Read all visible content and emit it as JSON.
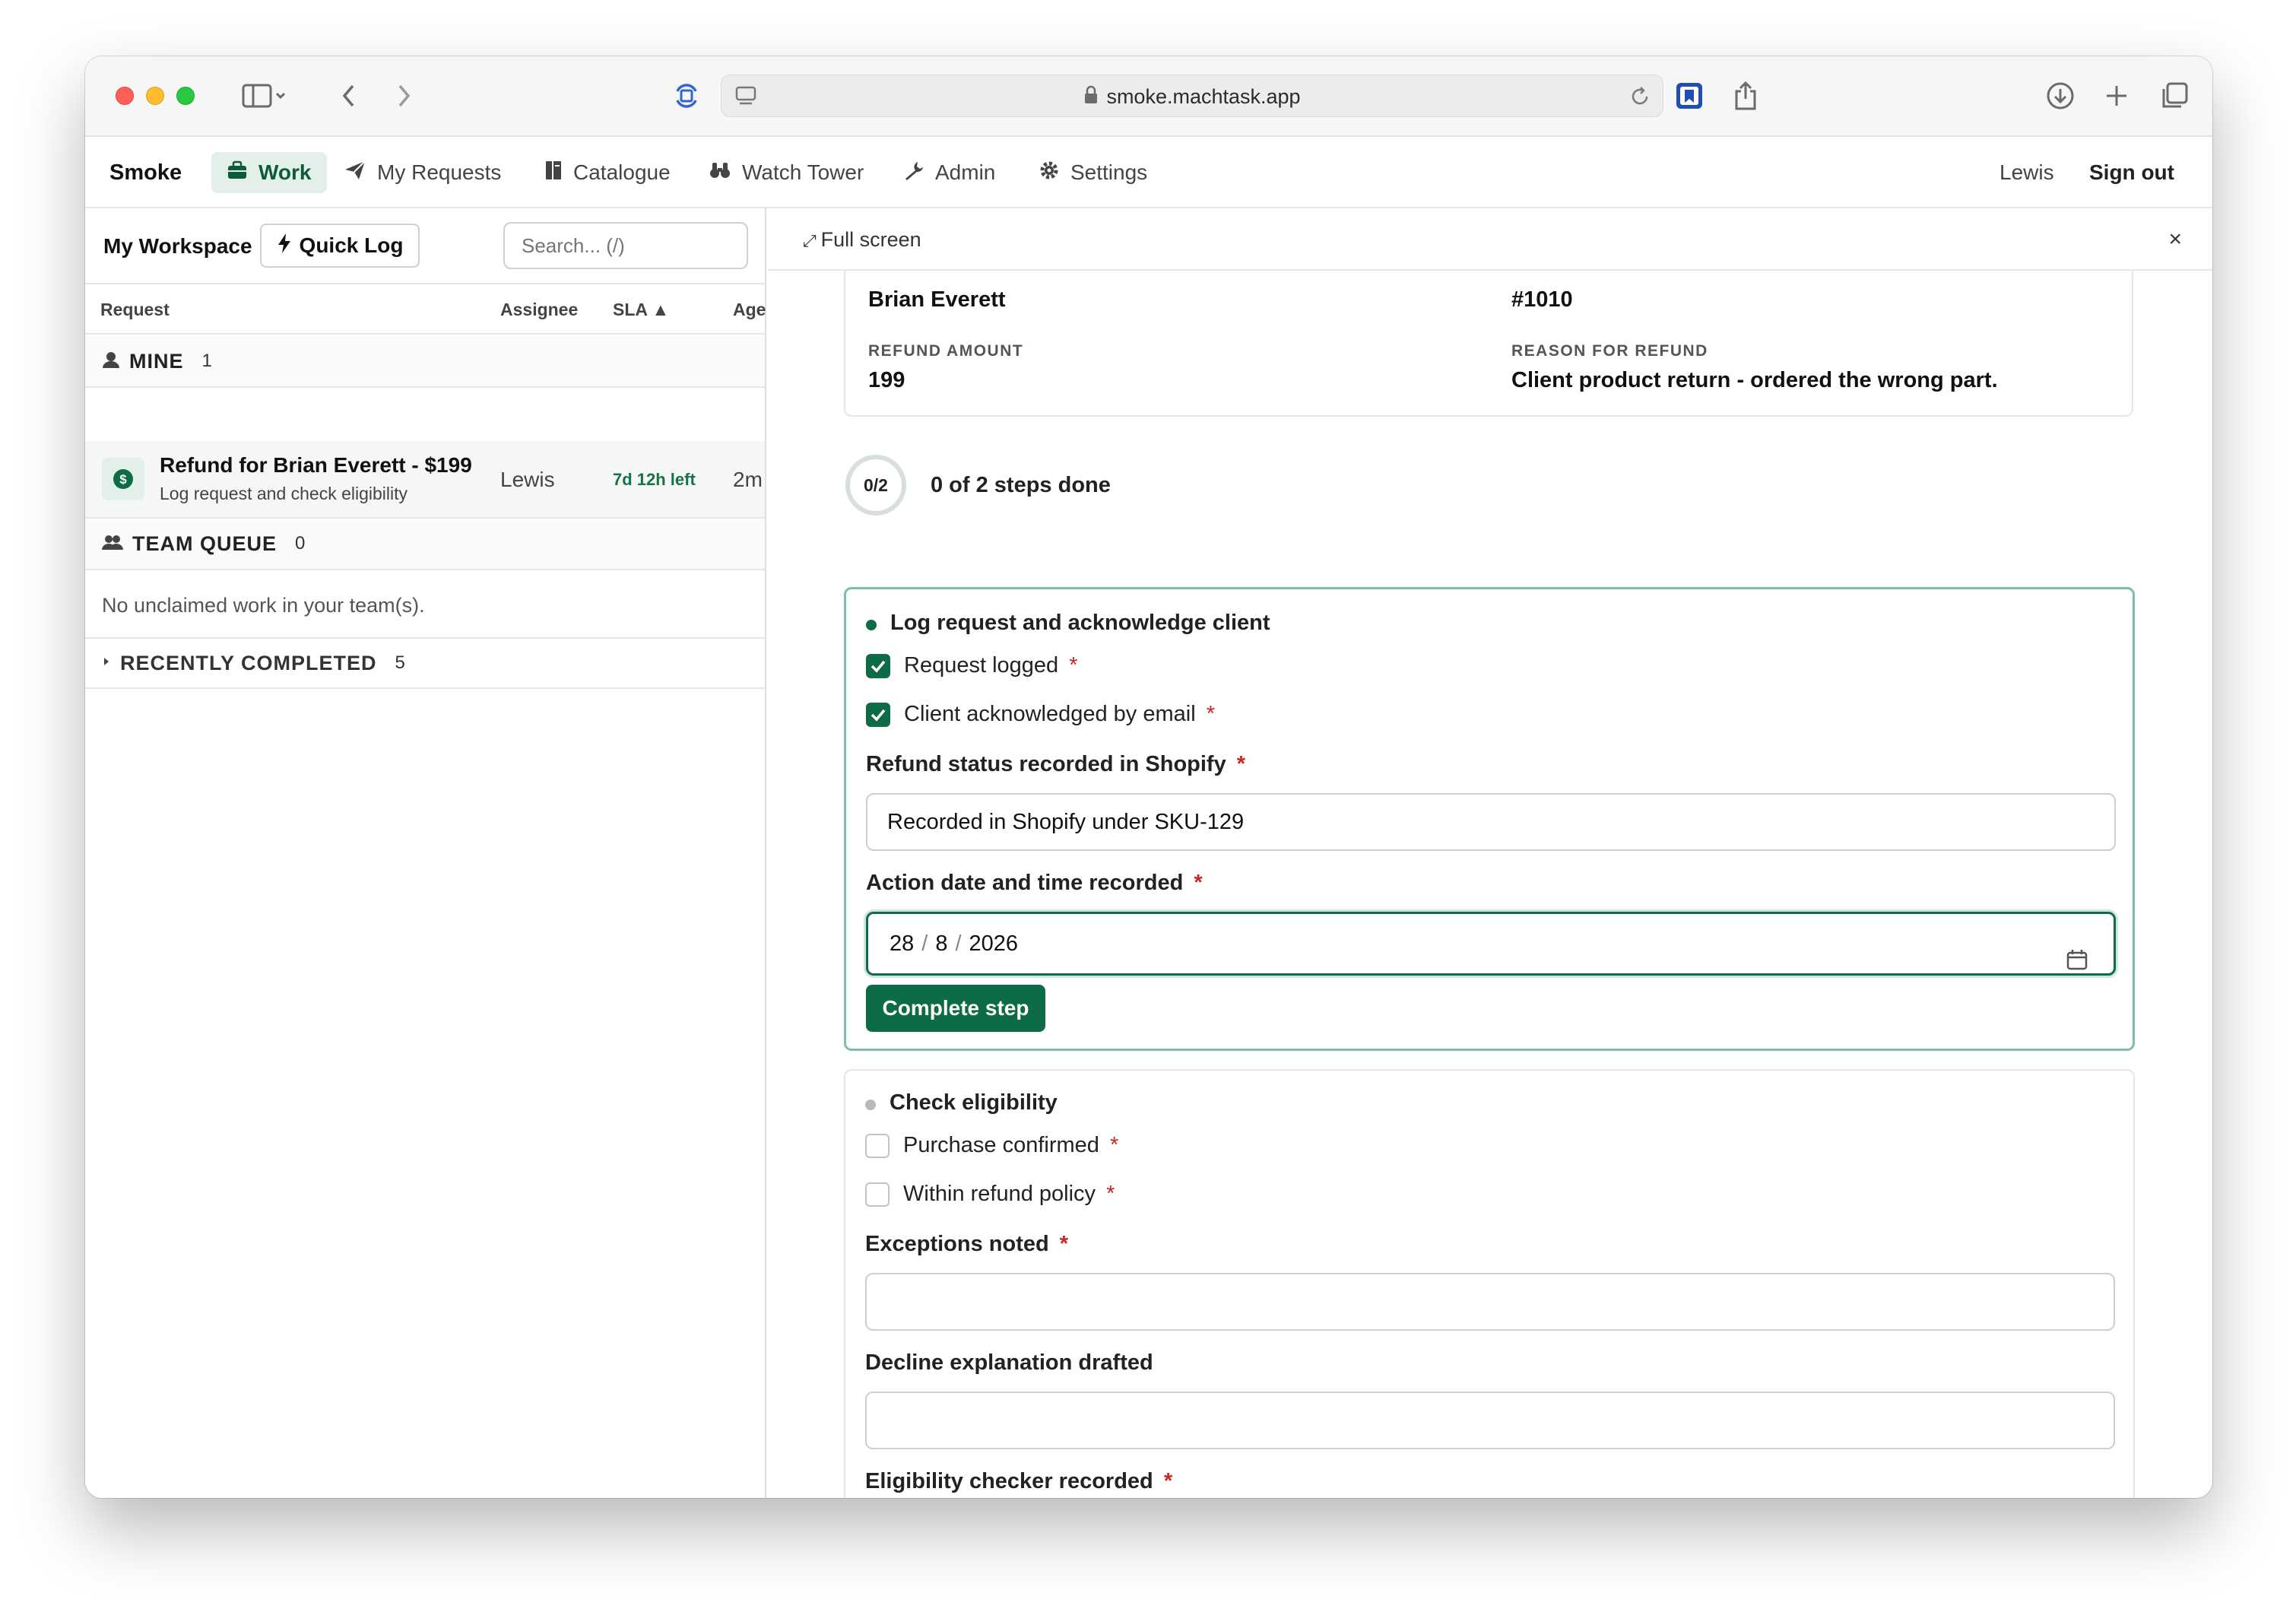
{
  "browser": {
    "url": "smoke.machtask.app"
  },
  "nav": {
    "brand": "Smoke",
    "items": [
      {
        "label": "Work",
        "icon": "briefcase-icon"
      },
      {
        "label": "My Requests",
        "icon": "paper-plane-icon"
      },
      {
        "label": "Catalogue",
        "icon": "book-icon"
      },
      {
        "label": "Watch Tower",
        "icon": "binoculars-icon"
      },
      {
        "label": "Admin",
        "icon": "wrench-icon"
      },
      {
        "label": "Settings",
        "icon": "gear-icon"
      }
    ],
    "user": "Lewis",
    "sign_out": "Sign out"
  },
  "workspace": {
    "title": "My Workspace",
    "quick_log": "Quick Log",
    "search_placeholder": "Search... (/)",
    "columns": {
      "request": "Request",
      "assignee": "Assignee",
      "sla": "SLA ▲",
      "age": "Age"
    },
    "mine": {
      "label": "MINE",
      "count": "1"
    },
    "request": {
      "title": "Refund for Brian Everett - $199",
      "subtitle": "Log request and check eligibility",
      "assignee": "Lewis",
      "sla": "7d 12h left",
      "age": "2m"
    },
    "team_queue": {
      "label": "TEAM QUEUE",
      "count": "0"
    },
    "empty_text": "No unclaimed work in your team(s).",
    "recently_completed": {
      "label": "RECENTLY COMPLETED",
      "count": "5"
    }
  },
  "detail": {
    "full_screen": "Full screen",
    "close": "×",
    "info": {
      "client_name_value": "Brian Everett",
      "invoice_value": "#1010",
      "refund_amount_label": "REFUND AMOUNT",
      "refund_amount_value": "199",
      "reason_label": "REASON FOR REFUND",
      "reason_value": "Client product return - ordered the wrong part."
    },
    "progress": {
      "fraction": "0/2",
      "label": "0 of 2 steps done",
      "done": 0,
      "total": 2
    },
    "step1": {
      "title": "Log request and acknowledge client",
      "checks": [
        {
          "label": "Request logged",
          "required": "*",
          "checked": true
        },
        {
          "label": "Client acknowledged by email",
          "required": "*",
          "checked": true
        }
      ],
      "field1_label": "Refund status recorded in Shopify",
      "field1_value": "Recorded in Shopify under SKU-129",
      "field2_label": "Action date and time recorded",
      "date_day": "28",
      "date_month": "8",
      "date_year": "2026",
      "button": "Complete step",
      "required": "*"
    },
    "step2": {
      "title": "Check eligibility",
      "checks": [
        {
          "label": "Purchase confirmed",
          "required": "*",
          "checked": false
        },
        {
          "label": "Within refund policy",
          "required": "*",
          "checked": false
        }
      ],
      "field1_label": "Exceptions noted",
      "field2_label": "Decline explanation drafted",
      "field3_label": "Eligibility checker recorded",
      "required": "*"
    }
  },
  "colors": {
    "accent": "#0e6b47",
    "accent_light": "#e3f0ea",
    "required": "#c62828",
    "sla": "#157346"
  }
}
